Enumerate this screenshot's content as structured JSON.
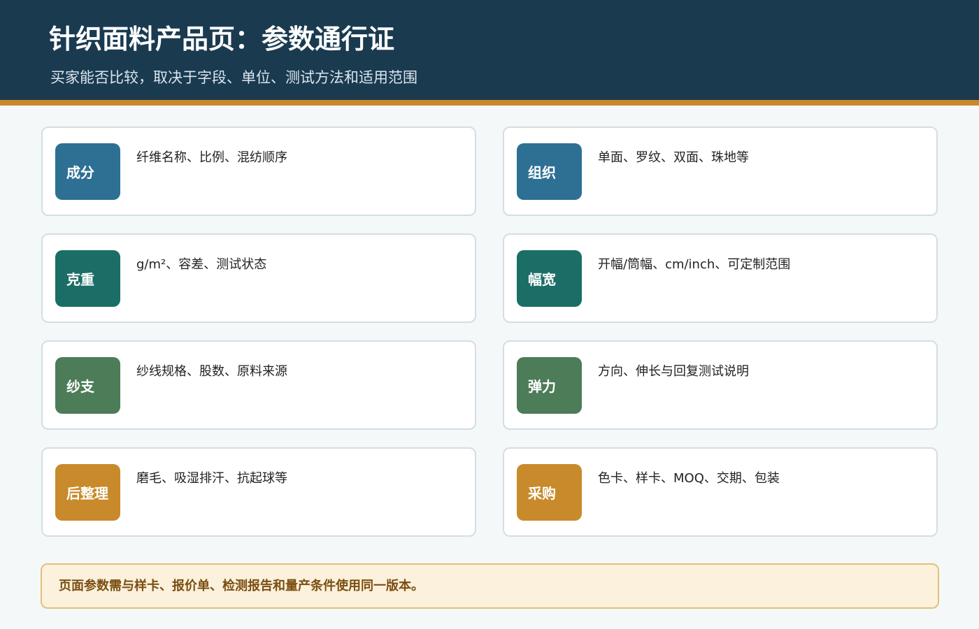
{
  "header": {
    "title": "针织面料产品页：参数通行证",
    "subtitle": "买家能否比较，取决于字段、单位、测试方法和适用范围"
  },
  "colors": {
    "header_bg": "#1a3a50",
    "accent": "#c8892a",
    "tag_blue": "#2e7094",
    "tag_teal": "#1b6e66",
    "tag_green": "#4c7c58",
    "tag_gold": "#c88a2a",
    "notice_bg": "#fcf1dc",
    "notice_text": "#7a4e12"
  },
  "params": [
    {
      "tag": "成分",
      "desc": "纤维名称、比例、混纺顺序"
    },
    {
      "tag": "组织",
      "desc": "单面、罗纹、双面、珠地等"
    },
    {
      "tag": "克重",
      "desc": "g/m²、容差、测试状态"
    },
    {
      "tag": "幅宽",
      "desc": "开幅/筒幅、cm/inch、可定制范围"
    },
    {
      "tag": "纱支",
      "desc": "纱线规格、股数、原料来源"
    },
    {
      "tag": "弹力",
      "desc": "方向、伸长与回复测试说明"
    },
    {
      "tag": "后整理",
      "desc": "磨毛、吸湿排汗、抗起球等"
    },
    {
      "tag": "采购",
      "desc": "色卡、样卡、MOQ、交期、包装"
    }
  ],
  "notice": {
    "text": "页面参数需与样卡、报价单、检测报告和量产条件使用同一版本。"
  }
}
